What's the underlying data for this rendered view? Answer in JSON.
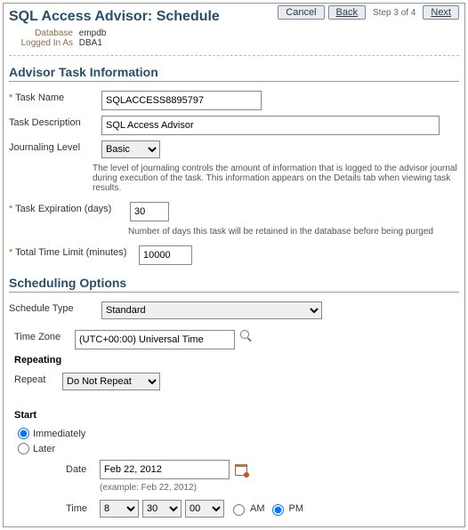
{
  "page_title": "SQL Access Advisor: Schedule",
  "db_info": {
    "database_label": "Database",
    "database_value": "empdb",
    "loggedin_label": "Logged In As",
    "loggedin_value": "DBA1"
  },
  "nav": {
    "cancel": "Cancel",
    "back": "Back",
    "step_text": "Step 3 of 4",
    "next": "Next"
  },
  "section_advisor": "Advisor Task Information",
  "task_name": {
    "label": "Task Name",
    "value": "SQLACCESS8895797"
  },
  "task_desc": {
    "label": "Task Description",
    "value": "SQL Access Advisor"
  },
  "journal": {
    "label": "Journaling Level",
    "value": "Basic",
    "hint": "The level of journaling controls the amount of information that is logged to the advisor journal during execution of the task. This information appears on the Details tab when viewing task results."
  },
  "expiration": {
    "label": "Task Expiration (days)",
    "value": "30",
    "hint": "Number of days this task will be retained in the database before being purged"
  },
  "time_limit": {
    "label": "Total Time Limit (minutes)",
    "value": "10000"
  },
  "section_sched": "Scheduling Options",
  "schedule_type": {
    "label": "Schedule Type",
    "value": "Standard"
  },
  "timezone": {
    "label": "Time Zone",
    "value": "(UTC+00:00) Universal Time"
  },
  "repeating": {
    "heading": "Repeating",
    "label": "Repeat",
    "value": "Do Not Repeat"
  },
  "start": {
    "heading": "Start",
    "immediately": "Immediately",
    "later": "Later",
    "date_label": "Date",
    "date_value": "Feb 22, 2012",
    "date_example": "(example: Feb 22, 2012)",
    "time_label": "Time",
    "hour": "8",
    "minute": "30",
    "second": "00",
    "am": "AM",
    "pm": "PM"
  }
}
